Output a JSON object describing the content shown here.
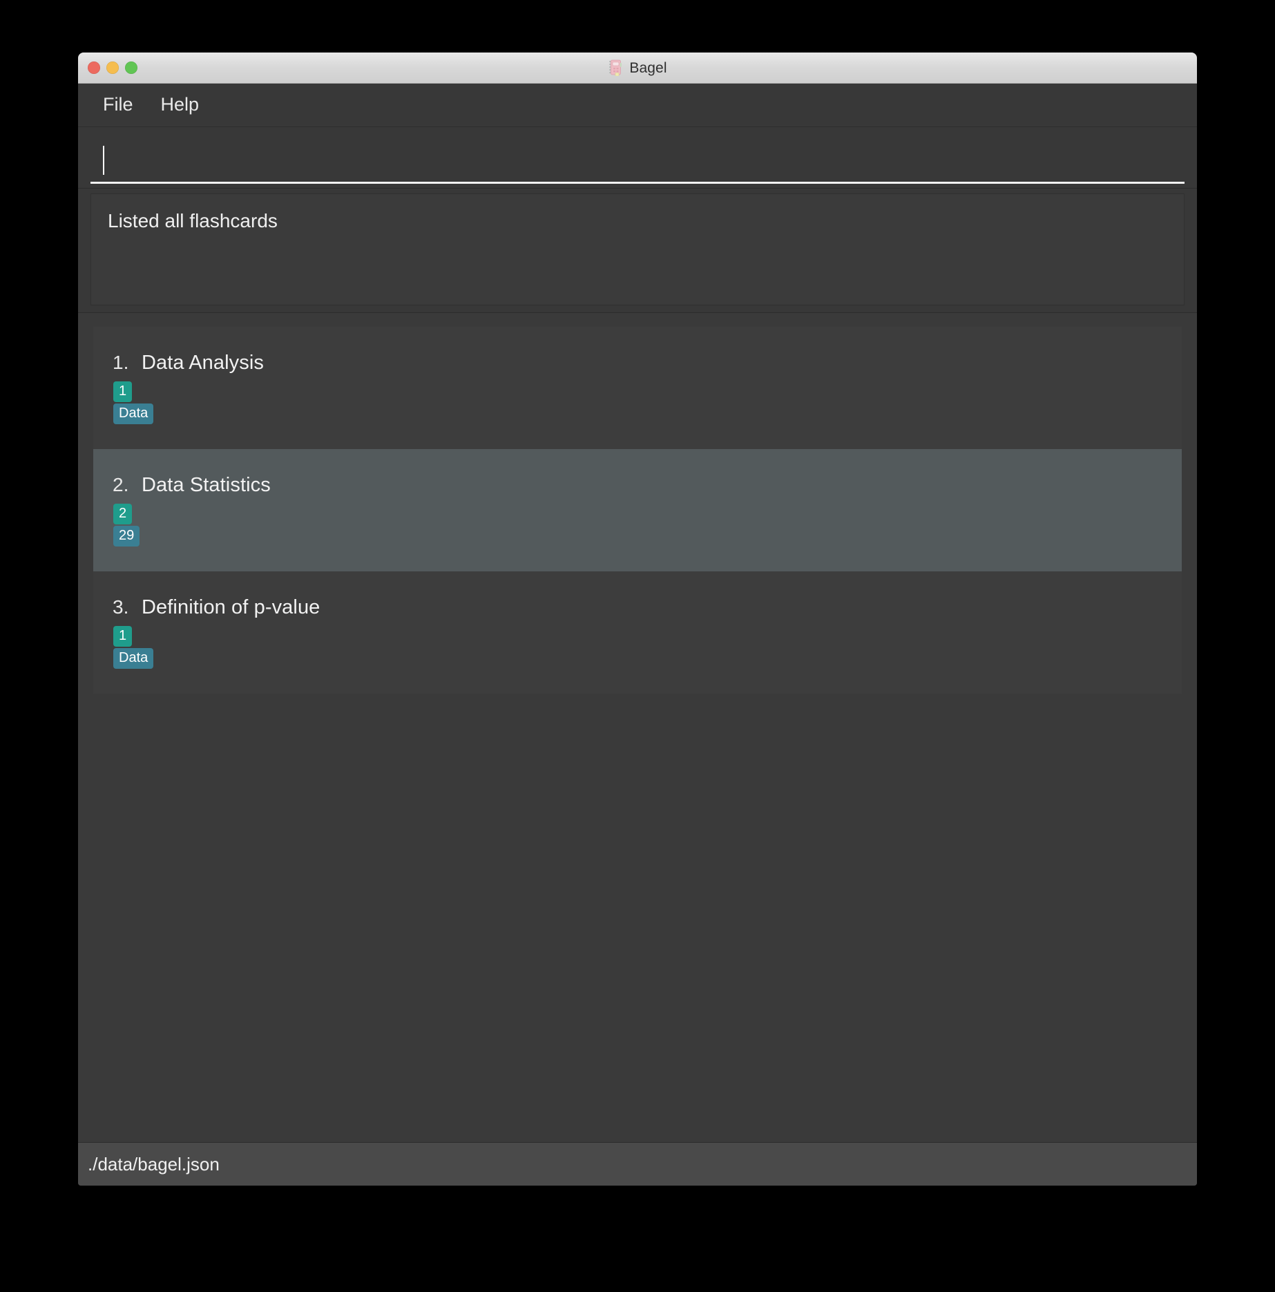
{
  "window": {
    "title": "Bagel",
    "app_icon": "flashcard-notebook-icon",
    "traffic_lights": {
      "close": "close-button",
      "minimize": "minimize-button",
      "maximize": "maximize-button"
    }
  },
  "menu": {
    "items": [
      {
        "label": "File"
      },
      {
        "label": "Help"
      }
    ]
  },
  "input": {
    "value": "",
    "placeholder": ""
  },
  "message": {
    "text": "Listed all flashcards"
  },
  "list": {
    "selected_index": 1,
    "items": [
      {
        "index": "1.",
        "title": "Data Analysis",
        "count_badge": "1",
        "tag_badge": "Data",
        "selected": false
      },
      {
        "index": "2.",
        "title": "Data Statistics",
        "count_badge": "2",
        "tag_badge": "29",
        "selected": true
      },
      {
        "index": "3.",
        "title": "Definition of p-value",
        "count_badge": "1",
        "tag_badge": "Data",
        "selected": false
      }
    ]
  },
  "status": {
    "path": "./data/bagel.json"
  },
  "colors": {
    "badge_count": "#1f9d8c",
    "badge_tag": "#3a7f93",
    "selection": "#535a5c",
    "window_bg": "#3a3a3a",
    "row_bg": "#3d3d3d",
    "status_bg": "#4a4a4a"
  }
}
